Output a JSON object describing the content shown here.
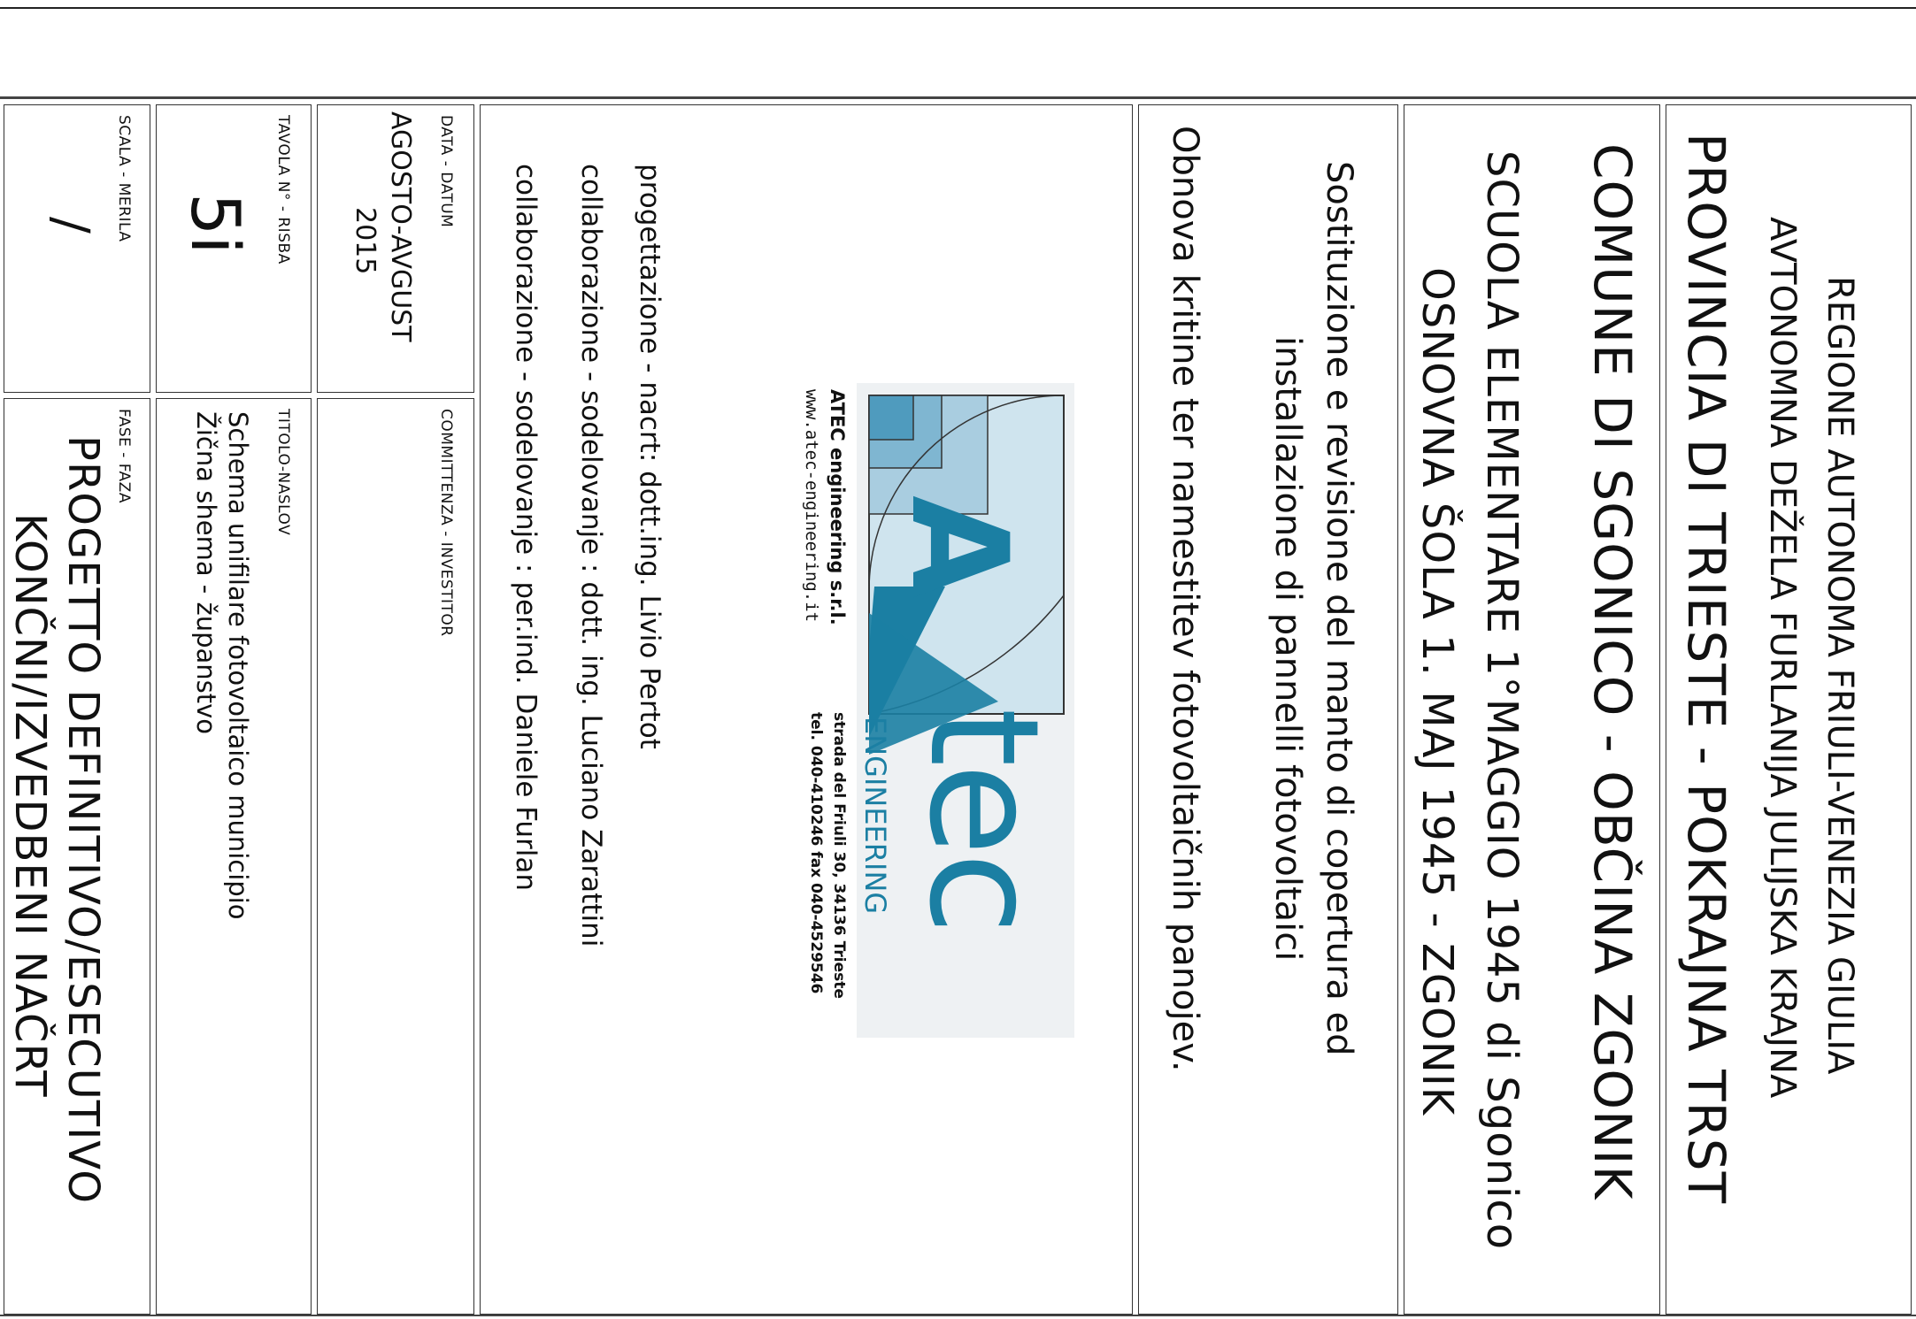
{
  "header": {
    "region_it": "REGIONE AUTONOMA FRIULI-VENEZIA GIULIA",
    "region_sl": "AVTONOMNA DEŽELA FURLANIJA JULIJSKA KRAJNA",
    "province": "PROVINCIA DI TRIESTE - POKRAJNA TRST",
    "municipality": "COMUNE DI SGONICO - OBČINA ZGONIK",
    "school_it": "SCUOLA ELEMENTARE 1°MAGGIO 1945 di Sgonico",
    "school_sl": "OSNOVNA ŠOLA 1. MAJ 1945 - ZGONIK"
  },
  "project": {
    "title_it_line1": "Sostituzione e revisione del manto di copertura ed",
    "title_it_line2": "installazione di pannelli fotovoltaici",
    "title_sl": "Obnova kritine ter namestitev fotovoltaičnih panojev."
  },
  "company": {
    "name": "ATEC engineering s.r.l.",
    "web": "www.atec-engineering.it",
    "address": "strada del Friuli 30, 34136 Trieste",
    "phone": "tel. 040-410246  fax 040-4529546",
    "logo_text": "tec",
    "logo_sub": "ENGINEERING",
    "logo_letter": "A"
  },
  "credits": {
    "design": "progettazione - nacrt:  dott.ing. Livio Pertot",
    "collab1": "collaborazione - sodelovanje  : dott. ing. Luciano Zarattini",
    "collab2": "collaborazione - sodelovanje : per.ind. Daniele Furlan"
  },
  "fields": {
    "date_label": "DATA - DATUM",
    "date_value_line1": "AGOSTO-AVGUST",
    "date_value_line2": "2015",
    "client_label": "COMMITTENZA - INVESTITOR",
    "drawing_label": "TAVOLA N° - RISBA",
    "drawing_value": "5i",
    "title_label": "TITOLO-NASLOV",
    "title_value_line1": "Schema unifilare fotovoltaico municipio",
    "title_value_line2": "Žična shema - županstvo",
    "scale_label": "SCALA - MERILA",
    "scale_value": "/",
    "phase_label": "FASE - FAZA",
    "phase_value_line1": "PROGETTO DEFINITIVO/ESECUTIVO",
    "phase_value_line2": "KONČNI/IZVEDBENI NAČRT"
  },
  "colors": {
    "logo_teal": "#1b7fa3",
    "logo_light": "#b9d7e4"
  }
}
